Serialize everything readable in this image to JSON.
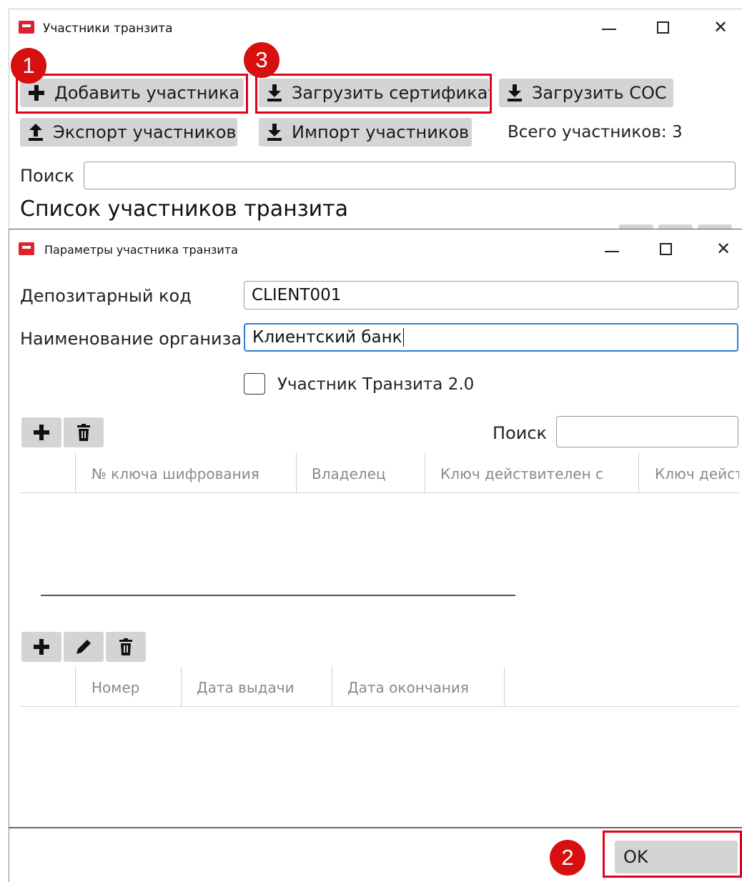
{
  "main_window": {
    "title": "Участники транзита",
    "toolbar": {
      "add_label": "Добавить участника",
      "upload_cert_label": "Загрузить сертификат",
      "upload_cos_label": "Загрузить СОС",
      "export_label": "Экспорт участников",
      "import_label": "Импорт участников",
      "total_label": "Всего участников: 3"
    },
    "search_label": "Поиск",
    "search_value": "",
    "list_heading": "Список участников транзита"
  },
  "dialog": {
    "title": "Параметры участника транзита",
    "fields": {
      "depo_code_label": "Депозитарный код",
      "depo_code_value": "CLIENT001",
      "org_name_label": "Наименование организа",
      "org_name_value": "Клиентский банк"
    },
    "transit2_label": "Участник Транзита 2.0",
    "transit2_checked": false,
    "keys_search_label": "Поиск",
    "keys_search_value": "",
    "keys_columns": [
      "№ ключа шифрования",
      "Владелец",
      "Ключ действителен с",
      "Ключ дейст"
    ],
    "certs_columns": [
      "Номер",
      "Дата выдачи",
      "Дата окончания"
    ],
    "ok_label": "OK"
  },
  "badges": [
    "1",
    "2",
    "3"
  ],
  "colors": {
    "highlight": "#e3001b",
    "badge": "#d70f0f",
    "button_bg": "#d4d4d4",
    "focus_border": "#2d7fd3",
    "app_icon": "#e0202a"
  },
  "icons": [
    "app-icon",
    "plus-icon",
    "download-icon",
    "upload-icon",
    "trash-icon",
    "pencil-icon",
    "minimize-icon",
    "maximize-icon",
    "close-icon"
  ]
}
